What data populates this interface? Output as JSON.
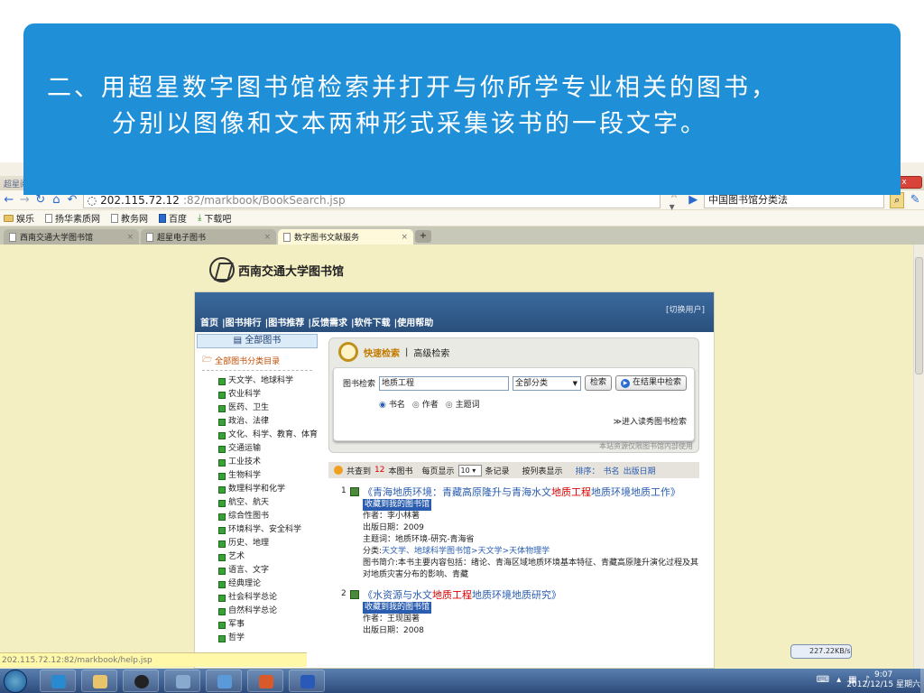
{
  "slide": {
    "line1": "二、用超星数字图书馆检索并打开与你所学专业相关的图书，",
    "line2": "分别以图像和文本两种形式采集该书的一段文字。"
  },
  "browser": {
    "app_title": "超星阅读器",
    "url_host": "202.115.72.12",
    "url_path": ":82/markbook/BookSearch.jsp",
    "search_text": "中国图书馆分类法",
    "bookmarks": [
      "娱乐",
      "扬华素质网",
      "教务网",
      "百度",
      "下载吧"
    ],
    "tabs": [
      "西南交通大学图书馆",
      "超星电子图书",
      "数字图书文献服务"
    ],
    "status_url": "202.115.72.12:82/markbook/help.jsp",
    "net_speed": "227.22KB/s"
  },
  "site": {
    "library_name": "西南交通大学图书馆",
    "switch_user": "[切换用户]",
    "menu": [
      "首页",
      "|图书排行",
      "|图书推荐",
      "|反馈需求",
      "|软件下载",
      "|使用帮助"
    ],
    "sidebar_title": "全部图书",
    "sidebar_sub": "全部图书分类目录",
    "categories": [
      "天文学、地球科学",
      "农业科学",
      "医药、卫生",
      "政治、法律",
      "文化、科学、教育、体育",
      "交通运输",
      "工业技术",
      "生物科学",
      "数理科学和化学",
      "航空、航天",
      "综合性图书",
      "环境科学、安全科学",
      "历史、地理",
      "艺术",
      "语言、文字",
      "经典理论",
      "社会科学总论",
      "自然科学总论",
      "军事",
      "哲学"
    ]
  },
  "search": {
    "quick_label": "快速检索",
    "sep": "|",
    "advanced_label": "高级检索",
    "field_label": "图书检索",
    "query": "地质工程",
    "category": "全部分类",
    "search_btn": "检索",
    "within_btn": "在结果中检索",
    "radio_title": "书名",
    "radio_author": "作者",
    "radio_subject": "主题词",
    "enter_link": "≫进入读秀图书检索",
    "note": "本站资源仅限图书馆内部使用"
  },
  "results_bar": {
    "found_pre": "共查到",
    "count": "12",
    "found_post": "本图书",
    "per_page_label": "每页显示",
    "per_page": "10",
    "records": "条记录",
    "list_view": "按列表显示",
    "sort_label": "排序：",
    "sort_title": "书名",
    "sort_date": "出版日期"
  },
  "results": [
    {
      "num": "1",
      "title_pre": "《青海地质环境：青藏高原隆升与青海水文",
      "title_hl": "地质工程",
      "title_post": "地质环境地质工作》",
      "collect": "收藏到我的图书馆",
      "author": "作者：李小林著",
      "date": "出版日期：2009",
      "subject": "主题词：地质环境-研究-青海省",
      "class_label": "分类:",
      "class_value": "天文学、地球科学图书馆>天文学>天体物理学",
      "summary": "图书简介:本书主要内容包括：绪论、青海区域地质环境基本特征、青藏高原隆升演化过程及其对地质灾害分布的影响、青藏"
    },
    {
      "num": "2",
      "title_pre": "《水资源与水文",
      "title_hl": "地质工程",
      "title_post": "地质环境地质研究》",
      "collect": "收藏到我的图书馆",
      "author": "作者：王现国著",
      "date": "出版日期：2008"
    }
  ],
  "taskbar": {
    "time": "9:07",
    "date": "2012/12/15 星期六"
  }
}
